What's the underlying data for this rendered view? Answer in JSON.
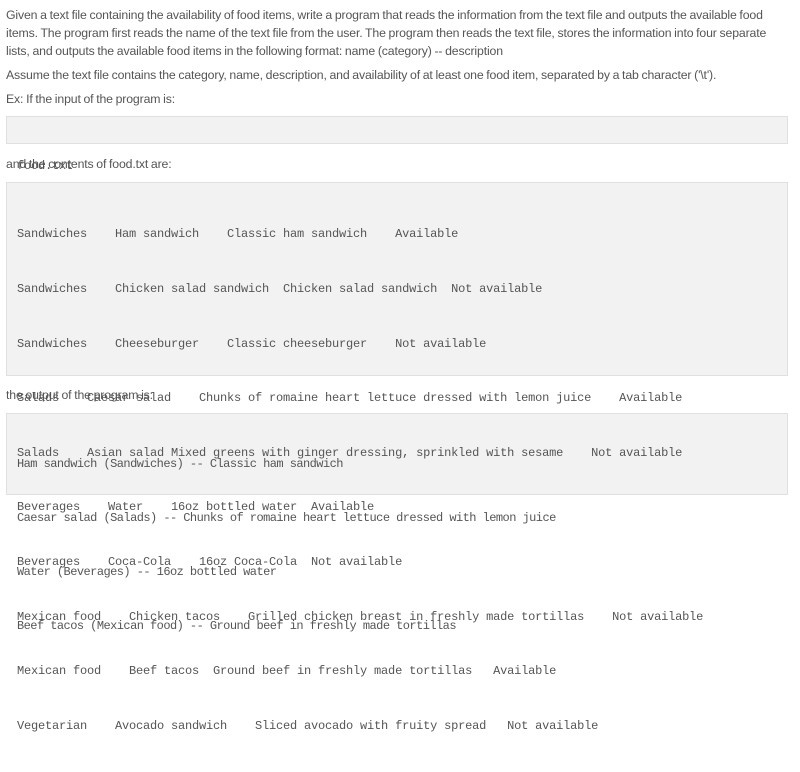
{
  "problem": {
    "intro": "Given a text file containing the availability of food items, write a program that reads the information from the text file and outputs the available food items. The program first reads the name of the text file from the user. The program then reads the text file, stores the information into four separate lists, and outputs the available food items in the following format: name (category) -- description",
    "assumption": "Assume the text file contains the category, name, description, and availability of at least one food item, separated by a tab character ('\\t').",
    "example_intro": "Ex: If the input of the program is:",
    "example_input": "food.txt",
    "file_contents_intro": "and the contents of food.txt are:",
    "file_lines": [
      "Sandwiches    Ham sandwich    Classic ham sandwich    Available",
      "Sandwiches    Chicken salad sandwich  Chicken salad sandwich  Not available",
      "Sandwiches    Cheeseburger    Classic cheeseburger    Not available",
      "Salads    Caesar salad    Chunks of romaine heart lettuce dressed with lemon juice    Available",
      "Salads    Asian salad Mixed greens with ginger dressing, sprinkled with sesame    Not available",
      "Beverages    Water    16oz bottled water  Available",
      "Beverages    Coca-Cola    16oz Coca-Cola  Not available",
      "Mexican food    Chicken tacos    Grilled chicken breast in freshly made tortillas    Not available",
      "Mexican food    Beef tacos  Ground beef in freshly made tortillas   Available",
      "Vegetarian    Avocado sandwich    Sliced avocado with fruity spread   Not available"
    ],
    "output_intro": "the output of the program is:",
    "output_lines": [
      "Ham sandwich (Sandwiches) -- Classic ham sandwich",
      "Caesar salad (Salads) -- Chunks of romaine heart lettuce dressed with lemon juice",
      "Water (Beverages) -- 16oz bottled water",
      "Beef tacos (Mexican food) -- Ground beef in freshly made tortillas"
    ]
  }
}
